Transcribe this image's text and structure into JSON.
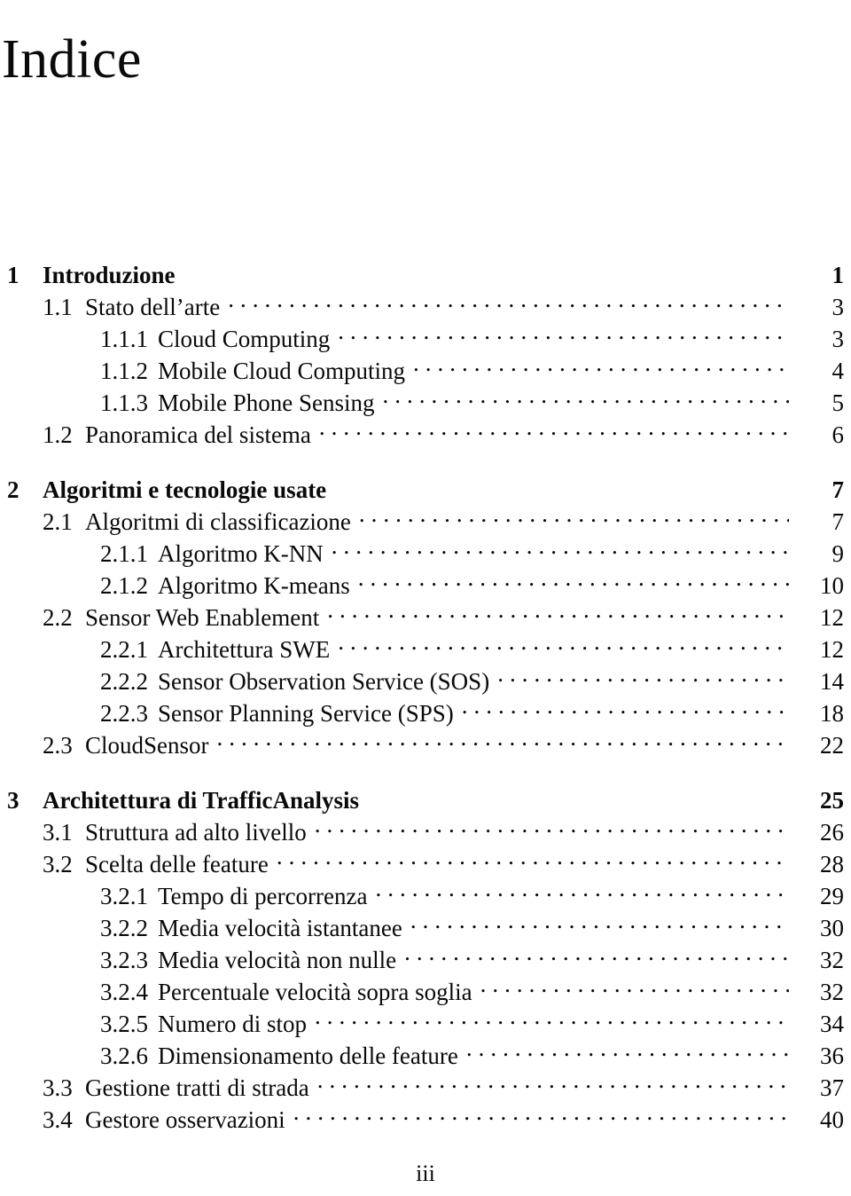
{
  "document": {
    "title": "Indice",
    "footer_page_number": "iii",
    "leader_dot_char": "."
  },
  "toc": {
    "entries": [
      {
        "number": "1",
        "label": "Introduzione",
        "page": "1",
        "level": "chapter",
        "gap_before": false
      },
      {
        "number": "1.1",
        "label": "Stato dell’arte",
        "page": "3",
        "level": "section",
        "gap_before": false
      },
      {
        "number": "1.1.1",
        "label": "Cloud Computing",
        "page": "3",
        "level": "subsection",
        "gap_before": false
      },
      {
        "number": "1.1.2",
        "label": "Mobile Cloud Computing",
        "page": "4",
        "level": "subsection",
        "gap_before": false
      },
      {
        "number": "1.1.3",
        "label": "Mobile Phone Sensing",
        "page": "5",
        "level": "subsection",
        "gap_before": false
      },
      {
        "number": "1.2",
        "label": "Panoramica del sistema",
        "page": "6",
        "level": "section",
        "gap_before": false
      },
      {
        "number": "2",
        "label": "Algoritmi e tecnologie usate",
        "page": "7",
        "level": "chapter",
        "gap_before": true
      },
      {
        "number": "2.1",
        "label": "Algoritmi di classificazione",
        "page": "7",
        "level": "section",
        "gap_before": false
      },
      {
        "number": "2.1.1",
        "label": "Algoritmo K-NN",
        "page": "9",
        "level": "subsection",
        "gap_before": false
      },
      {
        "number": "2.1.2",
        "label": "Algoritmo K-means",
        "page": "10",
        "level": "subsection",
        "gap_before": false
      },
      {
        "number": "2.2",
        "label": "Sensor Web Enablement",
        "page": "12",
        "level": "section",
        "gap_before": false
      },
      {
        "number": "2.2.1",
        "label": "Architettura SWE",
        "page": "12",
        "level": "subsection",
        "gap_before": false
      },
      {
        "number": "2.2.2",
        "label": "Sensor Observation Service (SOS)",
        "page": "14",
        "level": "subsection",
        "gap_before": false
      },
      {
        "number": "2.2.3",
        "label": "Sensor Planning Service (SPS)",
        "page": "18",
        "level": "subsection",
        "gap_before": false
      },
      {
        "number": "2.3",
        "label": "CloudSensor",
        "page": "22",
        "level": "section",
        "gap_before": false
      },
      {
        "number": "3",
        "label": "Architettura di TrafficAnalysis",
        "page": "25",
        "level": "chapter",
        "gap_before": true
      },
      {
        "number": "3.1",
        "label": "Struttura ad alto livello",
        "page": "26",
        "level": "section",
        "gap_before": false
      },
      {
        "number": "3.2",
        "label": "Scelta delle feature",
        "page": "28",
        "level": "section",
        "gap_before": false
      },
      {
        "number": "3.2.1",
        "label": "Tempo di percorrenza",
        "page": "29",
        "level": "subsection",
        "gap_before": false
      },
      {
        "number": "3.2.2",
        "label": "Media velocità istantanee",
        "page": "30",
        "level": "subsection",
        "gap_before": false
      },
      {
        "number": "3.2.3",
        "label": "Media velocità non nulle",
        "page": "32",
        "level": "subsection",
        "gap_before": false
      },
      {
        "number": "3.2.4",
        "label": "Percentuale velocità sopra soglia",
        "page": "32",
        "level": "subsection",
        "gap_before": false
      },
      {
        "number": "3.2.5",
        "label": "Numero di stop",
        "page": "34",
        "level": "subsection",
        "gap_before": false
      },
      {
        "number": "3.2.6",
        "label": "Dimensionamento delle feature",
        "page": "36",
        "level": "subsection",
        "gap_before": false
      },
      {
        "number": "3.3",
        "label": "Gestione tratti di strada",
        "page": "37",
        "level": "section",
        "gap_before": false
      },
      {
        "number": "3.4",
        "label": "Gestore osservazioni",
        "page": "40",
        "level": "section",
        "gap_before": false
      }
    ]
  }
}
